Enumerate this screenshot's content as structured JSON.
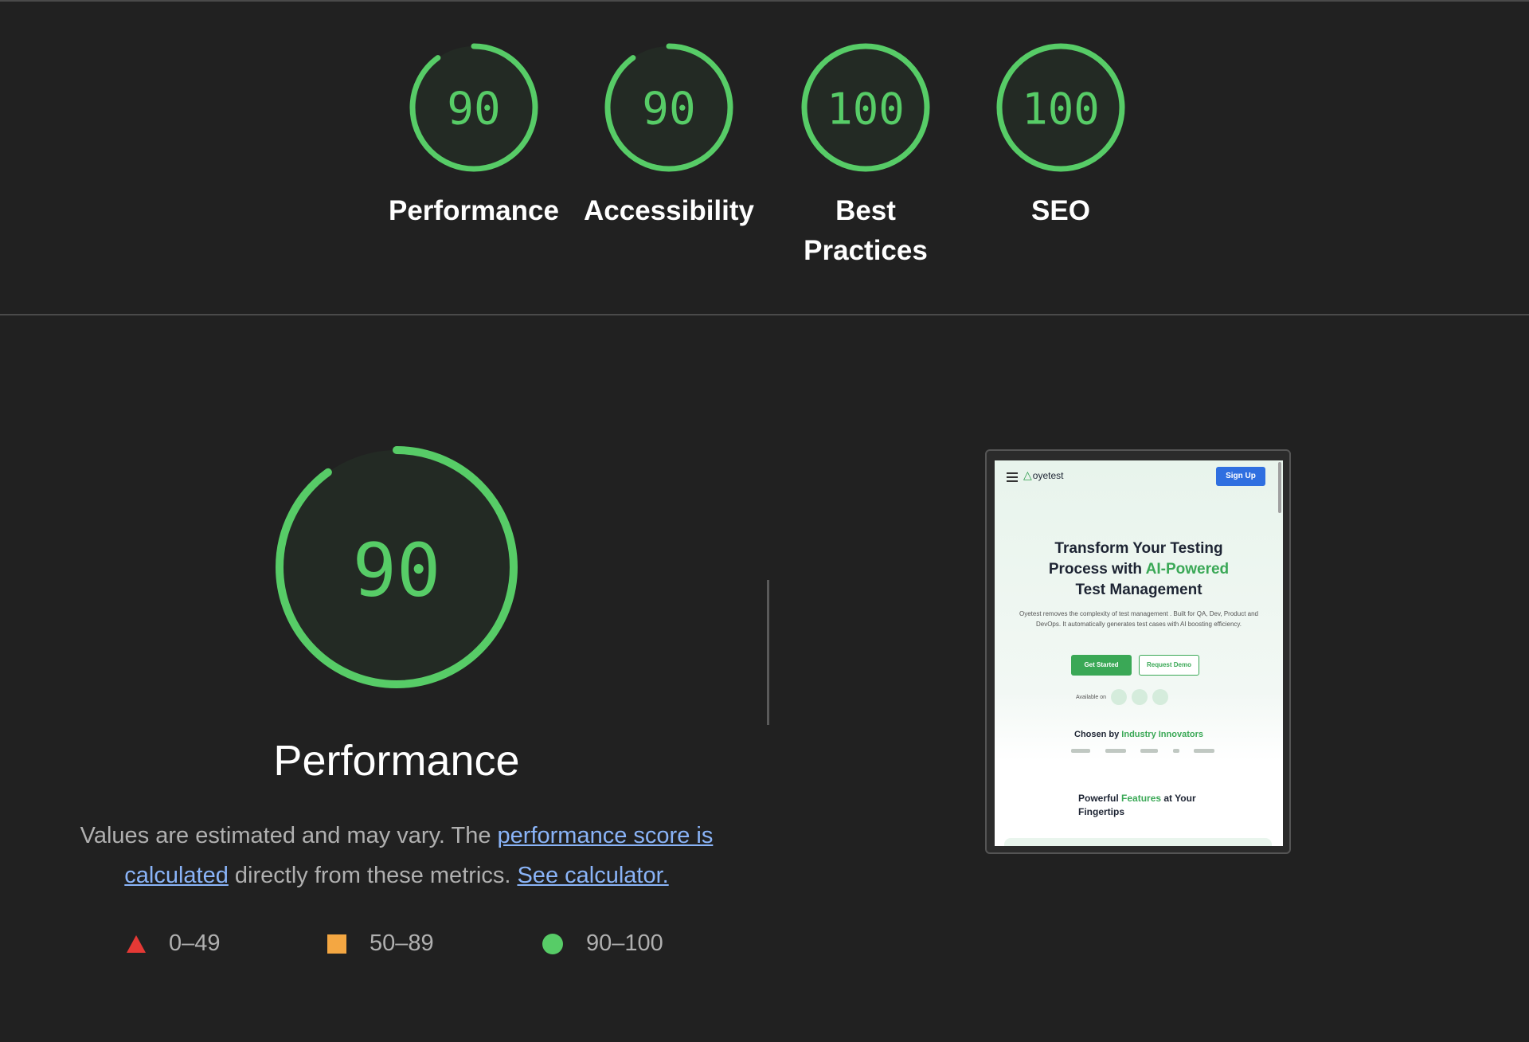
{
  "categories": [
    {
      "name": "Performance",
      "score": "90",
      "fraction": 0.9
    },
    {
      "name": "Accessibility",
      "score": "90",
      "fraction": 0.9
    },
    {
      "name": "Best Practices",
      "score": "100",
      "fraction": 1.0
    },
    {
      "name": "SEO",
      "score": "100",
      "fraction": 1.0
    }
  ],
  "performance": {
    "score": "90",
    "fraction": 0.9,
    "title": "Performance",
    "desc_prefix": "Values are estimated and may vary. The ",
    "link_score": "performance score is calculated",
    "desc_middle": " directly from these metrics. ",
    "link_calculator": "See calculator."
  },
  "legend": [
    {
      "shape": "triangle",
      "range": "0–49",
      "color": "#e53935"
    },
    {
      "shape": "square",
      "range": "50–89",
      "color": "#f4a742"
    },
    {
      "shape": "circle",
      "range": "90–100",
      "color": "#57cc67"
    }
  ],
  "colors": {
    "pass": "#57cc67",
    "gauge_bg": "#232a24",
    "link": "#8ab4f8"
  },
  "thumbnail": {
    "logo_text": "oyetest",
    "signup": "Sign Up",
    "headline_line1": "Transform Your Testing",
    "headline_line2_a": "Process with ",
    "headline_line2_b": "AI-Powered",
    "headline_line3": "Test Management",
    "subtext": "Oyetest removes the complexity of test management . Built for QA, Dev, Product and DevOps. It automatically generates test cases with AI boosting efficiency.",
    "get_started": "Get Started",
    "request_demo": "Request Demo",
    "available_on": "Available on",
    "chosen_a": "Chosen by ",
    "chosen_b": "Industry Innovators",
    "features_a": "Powerful ",
    "features_b": "Features",
    "features_c": " at Your Fingertips"
  }
}
